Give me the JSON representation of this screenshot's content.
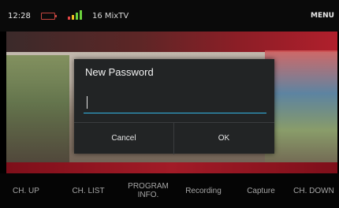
{
  "status_bar": {
    "time": "12:28",
    "battery_color": "#c2453f",
    "signal_colors": [
      "#e04545",
      "#f0c020",
      "#6bd13c",
      "#6bd13c"
    ],
    "channel": "16 MixTV",
    "menu_label": "MENU"
  },
  "dialog": {
    "title": "New Password",
    "password_value": "",
    "accent_color": "#33b5e5",
    "cancel_label": "Cancel",
    "ok_label": "OK"
  },
  "bottom_bar": {
    "items": [
      {
        "label": "CH. UP"
      },
      {
        "label": "CH. LIST"
      },
      {
        "line1": "PROGRAM",
        "line2": "INFO."
      },
      {
        "label": "Recording"
      },
      {
        "label": "Capture"
      },
      {
        "label": "CH. DOWN"
      }
    ]
  }
}
